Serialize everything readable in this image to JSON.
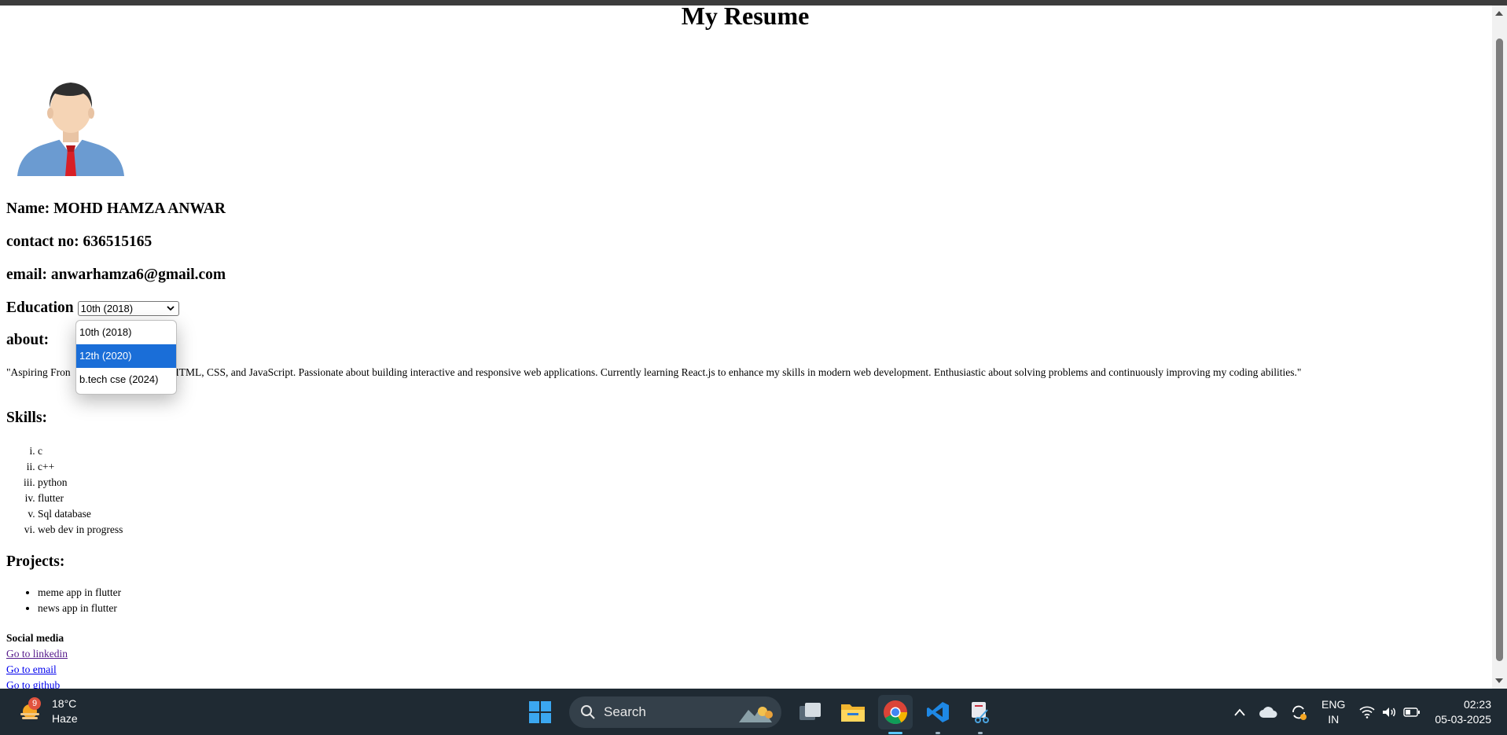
{
  "page": {
    "title": "My Resume",
    "name_line": "Name: MOHD HAMZA ANWAR",
    "contact_line": "contact no: 636515165",
    "email_line": "email: anwarhamza6@gmail.com",
    "education": {
      "label": "Education",
      "selected": "10th (2018)",
      "options": [
        "10th (2018)",
        "12th (2020)",
        "b.tech cse (2024)"
      ],
      "highlighted_option": "12th (2020)"
    },
    "about_heading": "about:",
    "about_text": "\"Aspiring Fron                       a strong foundation in HTML, CSS, and JavaScript. Passionate about building interactive and responsive web applications. Currently learning React.js to enhance my skills in modern web development. Enthusiastic about solving problems and continuously improving my coding abilities.\"",
    "skills_heading": "Skills:",
    "skills": [
      "c",
      "c++",
      "python",
      "flutter",
      "Sql database",
      "web dev in progress"
    ],
    "projects_heading": "Projects:",
    "projects": [
      "meme app in flutter",
      "news app in flutter"
    ],
    "social": {
      "heading": "Social media",
      "links": [
        "Go to linkedin",
        "Go to email",
        "Go to github"
      ]
    }
  },
  "taskbar": {
    "weather": {
      "badge": "9",
      "temp": "18°C",
      "condition": "Haze"
    },
    "search_placeholder": "Search",
    "apps": [
      "task-view-icon",
      "file-explorer-icon",
      "chrome-icon",
      "vscode-icon",
      "snipping-tool-icon"
    ],
    "tray": {
      "lang_top": "ENG",
      "lang_bottom": "IN",
      "time": "02:23",
      "date": "05-03-2025"
    }
  },
  "colors": {
    "selected_option_bg": "#1a6ed8",
    "link_visited": "#551a8b",
    "link": "#0000ee",
    "taskbar_bg": "#1f2a33"
  }
}
